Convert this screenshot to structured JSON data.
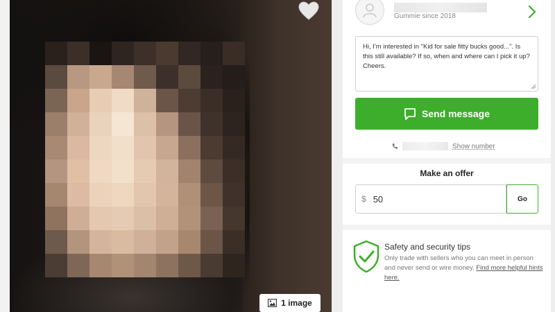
{
  "listing_image": {
    "badge_label": "1 image",
    "favorite_icon": "heart-icon",
    "badge_icon": "image-icon"
  },
  "seller": {
    "member_since": "Gummie since 2018",
    "avatar_icon": "user-avatar-icon",
    "chevron_icon": "chevron-right-icon"
  },
  "message": {
    "text": "Hi, I'm interested in \"Kid for sale fitty bucks good...\". Is this still available? If so, when and where can I pick it up? Cheers."
  },
  "send": {
    "label": "Send message",
    "icon": "chat-bubble-icon",
    "color": "#3dae2b"
  },
  "phone": {
    "show_number_label": "Show number",
    "icon": "phone-icon"
  },
  "offer": {
    "title": "Make an offer",
    "currency": "$",
    "value": "50",
    "go_label": "Go"
  },
  "safety": {
    "title": "Safety and security tips",
    "body": "Only trade with sellers who you can meet in person and never send or wire money.",
    "link_text": "Find more helpful hints here.",
    "icon": "shield-check-icon",
    "icon_color": "#3dae2b"
  }
}
